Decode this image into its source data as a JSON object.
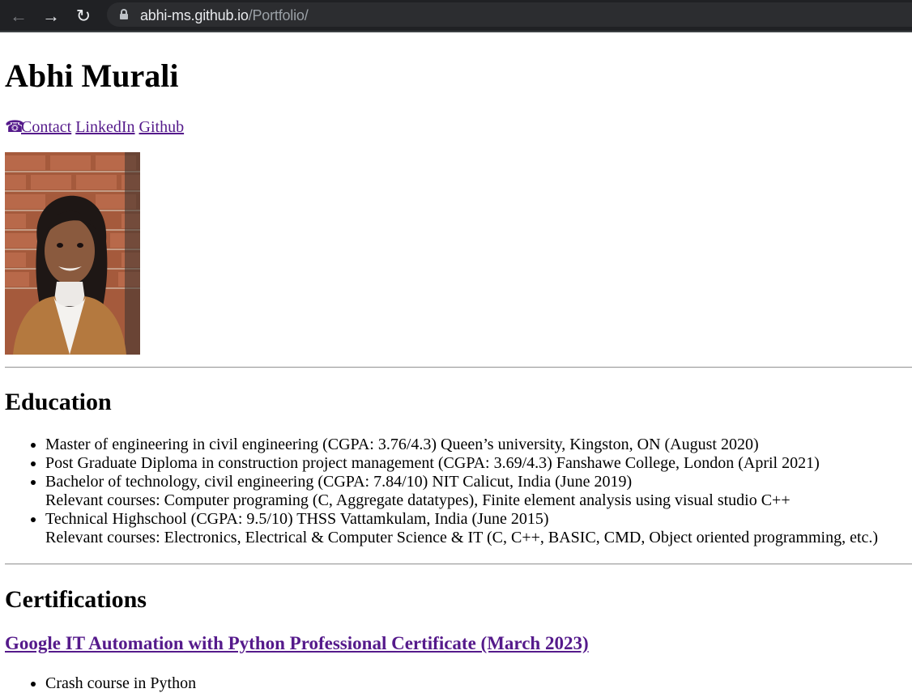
{
  "browser": {
    "url_host": "abhi-ms.github.io",
    "url_path": "/Portfolio/"
  },
  "header": {
    "name": "Abhi Murali",
    "links": [
      {
        "label": "Contact",
        "icon": "phone-icon"
      },
      {
        "label": "LinkedIn"
      },
      {
        "label": "Github"
      }
    ]
  },
  "education": {
    "heading": "Education",
    "items": [
      {
        "text": "Master of engineering in civil engineering (CGPA: 3.76/4.3) Queen’s university, Kingston, ON (August 2020)"
      },
      {
        "text": "Post Graduate Diploma in construction project management (CGPA: 3.69/4.3) Fanshawe College, London (April 2021)"
      },
      {
        "text": "Bachelor of technology, civil engineering (CGPA: 7.84/10) NIT Calicut, India (June 2019)",
        "sub": "Relevant courses: Computer programing (C, Aggregate datatypes), Finite element analysis using visual studio C++"
      },
      {
        "text": "Technical Highschool (CGPA: 9.5/10) THSS Vattamkulam, India (June 2015)",
        "sub": "Relevant courses: Electronics, Electrical & Computer Science & IT (C, C++, BASIC, CMD, Object oriented programming, etc.)"
      }
    ]
  },
  "certifications": {
    "heading": "Certifications",
    "cert_title": "Google IT Automation with Python Professional Certificate (March 2023)",
    "items": [
      "Crash course in Python"
    ]
  },
  "colors": {
    "link": "#551a8b",
    "chrome_bg": "#202124"
  }
}
